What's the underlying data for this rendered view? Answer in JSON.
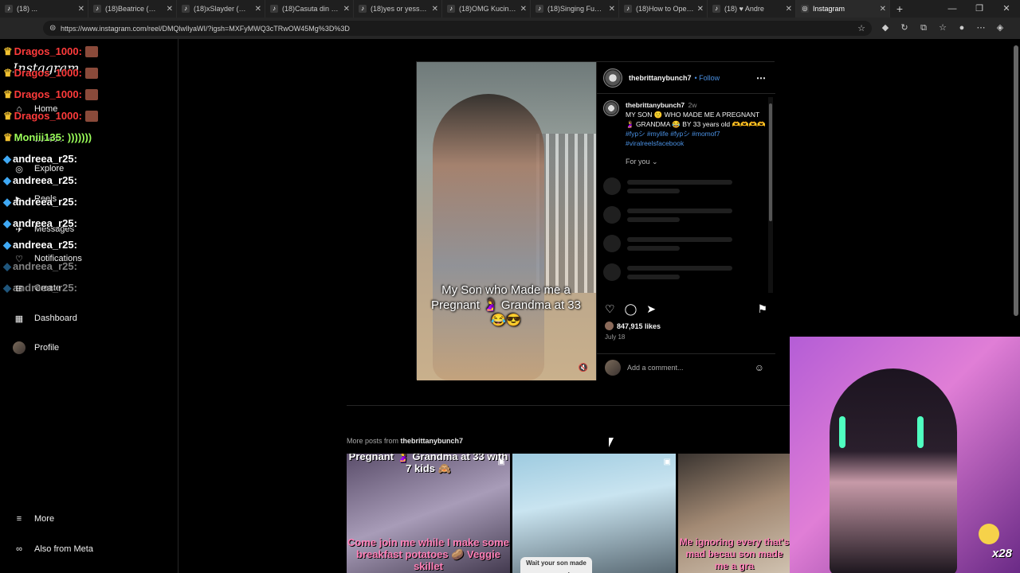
{
  "tabs": [
    {
      "label": "(18) ...",
      "icon": "tiktok-icon"
    },
    {
      "label": "(18)Beatrice (@beat",
      "icon": "tiktok-icon"
    },
    {
      "label": "(18)xSlayder (@xsla",
      "icon": "tiktok-icon"
    },
    {
      "label": "(18)Casuta din padu",
      "icon": "tiktok-icon"
    },
    {
      "label": "(18)yes or yess ❤️",
      "icon": "tiktok-icon"
    },
    {
      "label": "(18)OMG Kucing, H",
      "icon": "tiktok-icon"
    },
    {
      "label": "(18)Singing Fun for",
      "icon": "tiktok-icon"
    },
    {
      "label": "(18)How to Open a",
      "icon": "tiktok-icon"
    },
    {
      "label": "(18) ♥ Andre",
      "icon": "tiktok-icon"
    },
    {
      "label": "Instagram",
      "icon": "instagram-icon",
      "active": true
    }
  ],
  "address": {
    "url": "https://www.instagram.com/reel/DMQlwIlyaWI/?igsh=MXFyMWQ3cTRwOW45Mg%3D%3D"
  },
  "sidebar": {
    "logo": "Instagram",
    "items": [
      {
        "label": "Home",
        "icon": "home-icon"
      },
      {
        "label": "Search",
        "icon": "search-icon"
      },
      {
        "label": "Explore",
        "icon": "explore-icon"
      },
      {
        "label": "Reels",
        "icon": "reels-icon"
      },
      {
        "label": "Messages",
        "icon": "messages-icon"
      },
      {
        "label": "Notifications",
        "icon": "heart-icon"
      },
      {
        "label": "Create",
        "icon": "plus-icon"
      },
      {
        "label": "Dashboard",
        "icon": "dashboard-icon"
      },
      {
        "label": "Profile",
        "icon": "avatar"
      },
      {
        "label": "More",
        "icon": "menu-icon"
      },
      {
        "label": "Also from Meta",
        "icon": "meta-icon"
      }
    ]
  },
  "chat": [
    {
      "user": "Dragos_1000:",
      "color": "#ff3b3b",
      "badge": "crown"
    },
    {
      "user": "Dragos_1000:",
      "color": "#ff3b3b",
      "badge": "crown"
    },
    {
      "user": "Dragos_1000:",
      "color": "#ff3b3b",
      "badge": "crown"
    },
    {
      "user": "Dragos_1000:",
      "color": "#ff3b3b",
      "badge": "crown"
    },
    {
      "user": "Moniii135: )))))))",
      "color": "#9bff5a",
      "badge": "crown"
    },
    {
      "user": "andreea_r25:",
      "color": "#ffffff",
      "badge": "gem"
    },
    {
      "user": "andreea_r25:",
      "color": "#ffffff",
      "badge": "gem"
    },
    {
      "user": "andreea_r25:",
      "color": "#ffffff",
      "badge": "gem"
    },
    {
      "user": "andreea_r25:",
      "color": "#ffffff",
      "badge": "gem"
    },
    {
      "user": "andreea_r25:",
      "color": "#ffffff",
      "badge": "gem"
    },
    {
      "user": "andreea_r25:",
      "color": "#ffffff",
      "badge": "gem"
    },
    {
      "user": "andreea_r25:",
      "color": "#ffffff",
      "badge": "gem"
    }
  ],
  "post": {
    "username": "thebrittanybunch7",
    "follow": "Follow",
    "time": "2w",
    "caption": "MY SON 🙂 WHO MADE ME A PREGNANT 🤰 GRANDMA 😂 BY 33 years old 🫶🫶🫶🫶",
    "hashtags": "#fypシ #mylife #fypシ #momof7 #viralreelsfacebook",
    "for_you": "For you ⌄",
    "video_caption": "My Son who Made me a Pregnant 🤰 Grandma at 33 😂😎",
    "likes": "847,915 likes",
    "date": "July 18",
    "add_comment_placeholder": "Add a comment..."
  },
  "more_posts": {
    "prefix": "More posts from",
    "username": "thebrittanybunch7",
    "thumbs": [
      {
        "top_text": "Pregnant 🤰 Grandma at 33 with 7 kids 🙈",
        "bottom_text": "Come join me while I make some breakfast potatoes 🥔 Veggie skillet"
      },
      {
        "top_text": "",
        "bottom_text": "Wait your son made you a grandma"
      },
      {
        "top_text": "",
        "bottom_text": "Me ignoring every that's mad becau son made me a gra"
      }
    ]
  },
  "webcam": {
    "gift_count": "x28"
  }
}
